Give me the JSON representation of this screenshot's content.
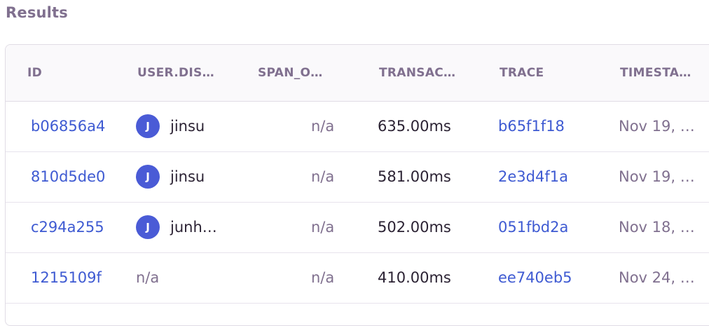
{
  "header": {
    "title": "Results"
  },
  "columns": [
    "ID",
    "USER.DIS…",
    "SPAN_O…",
    "TRANSAC…",
    "TRACE",
    "TIMESTA…"
  ],
  "rows": [
    {
      "id": "b06856a4",
      "avatar": "J",
      "user": "jinsu",
      "span": "n/a",
      "duration": "635.00ms",
      "trace": "b65f1f18",
      "timestamp": "Nov 19, …"
    },
    {
      "id": "810d5de0",
      "avatar": "J",
      "user": "jinsu",
      "span": "n/a",
      "duration": "581.00ms",
      "trace": "2e3d4f1a",
      "timestamp": "Nov 19, …"
    },
    {
      "id": "c294a255",
      "avatar": "J",
      "user": "junh…",
      "span": "n/a",
      "duration": "502.00ms",
      "trace": "051fbd2a",
      "timestamp": "Nov 18, …"
    },
    {
      "id": "1215109f",
      "avatar": null,
      "user": "n/a",
      "span": "n/a",
      "duration": "410.00ms",
      "trace": "ee740eb5",
      "timestamp": "Nov 24, …"
    }
  ],
  "colors": {
    "link": "#3e5ad2",
    "muted": "#80708f",
    "avatar_bg": "#4a5bd6",
    "text": "#2b2233"
  }
}
